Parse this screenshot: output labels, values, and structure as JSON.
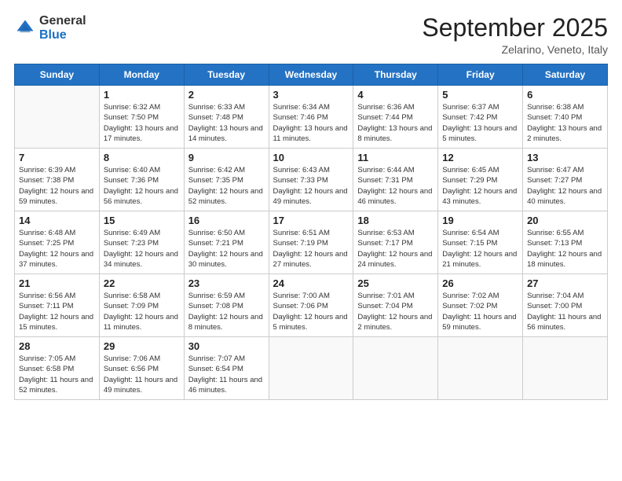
{
  "header": {
    "logo_general": "General",
    "logo_blue": "Blue",
    "month_title": "September 2025",
    "location": "Zelarino, Veneto, Italy"
  },
  "days_of_week": [
    "Sunday",
    "Monday",
    "Tuesday",
    "Wednesday",
    "Thursday",
    "Friday",
    "Saturday"
  ],
  "weeks": [
    [
      {
        "num": "",
        "sunrise": "",
        "sunset": "",
        "daylight": "",
        "empty": true
      },
      {
        "num": "1",
        "sunrise": "Sunrise: 6:32 AM",
        "sunset": "Sunset: 7:50 PM",
        "daylight": "Daylight: 13 hours and 17 minutes.",
        "empty": false
      },
      {
        "num": "2",
        "sunrise": "Sunrise: 6:33 AM",
        "sunset": "Sunset: 7:48 PM",
        "daylight": "Daylight: 13 hours and 14 minutes.",
        "empty": false
      },
      {
        "num": "3",
        "sunrise": "Sunrise: 6:34 AM",
        "sunset": "Sunset: 7:46 PM",
        "daylight": "Daylight: 13 hours and 11 minutes.",
        "empty": false
      },
      {
        "num": "4",
        "sunrise": "Sunrise: 6:36 AM",
        "sunset": "Sunset: 7:44 PM",
        "daylight": "Daylight: 13 hours and 8 minutes.",
        "empty": false
      },
      {
        "num": "5",
        "sunrise": "Sunrise: 6:37 AM",
        "sunset": "Sunset: 7:42 PM",
        "daylight": "Daylight: 13 hours and 5 minutes.",
        "empty": false
      },
      {
        "num": "6",
        "sunrise": "Sunrise: 6:38 AM",
        "sunset": "Sunset: 7:40 PM",
        "daylight": "Daylight: 13 hours and 2 minutes.",
        "empty": false
      }
    ],
    [
      {
        "num": "7",
        "sunrise": "Sunrise: 6:39 AM",
        "sunset": "Sunset: 7:38 PM",
        "daylight": "Daylight: 12 hours and 59 minutes.",
        "empty": false
      },
      {
        "num": "8",
        "sunrise": "Sunrise: 6:40 AM",
        "sunset": "Sunset: 7:36 PM",
        "daylight": "Daylight: 12 hours and 56 minutes.",
        "empty": false
      },
      {
        "num": "9",
        "sunrise": "Sunrise: 6:42 AM",
        "sunset": "Sunset: 7:35 PM",
        "daylight": "Daylight: 12 hours and 52 minutes.",
        "empty": false
      },
      {
        "num": "10",
        "sunrise": "Sunrise: 6:43 AM",
        "sunset": "Sunset: 7:33 PM",
        "daylight": "Daylight: 12 hours and 49 minutes.",
        "empty": false
      },
      {
        "num": "11",
        "sunrise": "Sunrise: 6:44 AM",
        "sunset": "Sunset: 7:31 PM",
        "daylight": "Daylight: 12 hours and 46 minutes.",
        "empty": false
      },
      {
        "num": "12",
        "sunrise": "Sunrise: 6:45 AM",
        "sunset": "Sunset: 7:29 PM",
        "daylight": "Daylight: 12 hours and 43 minutes.",
        "empty": false
      },
      {
        "num": "13",
        "sunrise": "Sunrise: 6:47 AM",
        "sunset": "Sunset: 7:27 PM",
        "daylight": "Daylight: 12 hours and 40 minutes.",
        "empty": false
      }
    ],
    [
      {
        "num": "14",
        "sunrise": "Sunrise: 6:48 AM",
        "sunset": "Sunset: 7:25 PM",
        "daylight": "Daylight: 12 hours and 37 minutes.",
        "empty": false
      },
      {
        "num": "15",
        "sunrise": "Sunrise: 6:49 AM",
        "sunset": "Sunset: 7:23 PM",
        "daylight": "Daylight: 12 hours and 34 minutes.",
        "empty": false
      },
      {
        "num": "16",
        "sunrise": "Sunrise: 6:50 AM",
        "sunset": "Sunset: 7:21 PM",
        "daylight": "Daylight: 12 hours and 30 minutes.",
        "empty": false
      },
      {
        "num": "17",
        "sunrise": "Sunrise: 6:51 AM",
        "sunset": "Sunset: 7:19 PM",
        "daylight": "Daylight: 12 hours and 27 minutes.",
        "empty": false
      },
      {
        "num": "18",
        "sunrise": "Sunrise: 6:53 AM",
        "sunset": "Sunset: 7:17 PM",
        "daylight": "Daylight: 12 hours and 24 minutes.",
        "empty": false
      },
      {
        "num": "19",
        "sunrise": "Sunrise: 6:54 AM",
        "sunset": "Sunset: 7:15 PM",
        "daylight": "Daylight: 12 hours and 21 minutes.",
        "empty": false
      },
      {
        "num": "20",
        "sunrise": "Sunrise: 6:55 AM",
        "sunset": "Sunset: 7:13 PM",
        "daylight": "Daylight: 12 hours and 18 minutes.",
        "empty": false
      }
    ],
    [
      {
        "num": "21",
        "sunrise": "Sunrise: 6:56 AM",
        "sunset": "Sunset: 7:11 PM",
        "daylight": "Daylight: 12 hours and 15 minutes.",
        "empty": false
      },
      {
        "num": "22",
        "sunrise": "Sunrise: 6:58 AM",
        "sunset": "Sunset: 7:09 PM",
        "daylight": "Daylight: 12 hours and 11 minutes.",
        "empty": false
      },
      {
        "num": "23",
        "sunrise": "Sunrise: 6:59 AM",
        "sunset": "Sunset: 7:08 PM",
        "daylight": "Daylight: 12 hours and 8 minutes.",
        "empty": false
      },
      {
        "num": "24",
        "sunrise": "Sunrise: 7:00 AM",
        "sunset": "Sunset: 7:06 PM",
        "daylight": "Daylight: 12 hours and 5 minutes.",
        "empty": false
      },
      {
        "num": "25",
        "sunrise": "Sunrise: 7:01 AM",
        "sunset": "Sunset: 7:04 PM",
        "daylight": "Daylight: 12 hours and 2 minutes.",
        "empty": false
      },
      {
        "num": "26",
        "sunrise": "Sunrise: 7:02 AM",
        "sunset": "Sunset: 7:02 PM",
        "daylight": "Daylight: 11 hours and 59 minutes.",
        "empty": false
      },
      {
        "num": "27",
        "sunrise": "Sunrise: 7:04 AM",
        "sunset": "Sunset: 7:00 PM",
        "daylight": "Daylight: 11 hours and 56 minutes.",
        "empty": false
      }
    ],
    [
      {
        "num": "28",
        "sunrise": "Sunrise: 7:05 AM",
        "sunset": "Sunset: 6:58 PM",
        "daylight": "Daylight: 11 hours and 52 minutes.",
        "empty": false
      },
      {
        "num": "29",
        "sunrise": "Sunrise: 7:06 AM",
        "sunset": "Sunset: 6:56 PM",
        "daylight": "Daylight: 11 hours and 49 minutes.",
        "empty": false
      },
      {
        "num": "30",
        "sunrise": "Sunrise: 7:07 AM",
        "sunset": "Sunset: 6:54 PM",
        "daylight": "Daylight: 11 hours and 46 minutes.",
        "empty": false
      },
      {
        "num": "",
        "sunrise": "",
        "sunset": "",
        "daylight": "",
        "empty": true
      },
      {
        "num": "",
        "sunrise": "",
        "sunset": "",
        "daylight": "",
        "empty": true
      },
      {
        "num": "",
        "sunrise": "",
        "sunset": "",
        "daylight": "",
        "empty": true
      },
      {
        "num": "",
        "sunrise": "",
        "sunset": "",
        "daylight": "",
        "empty": true
      }
    ]
  ]
}
